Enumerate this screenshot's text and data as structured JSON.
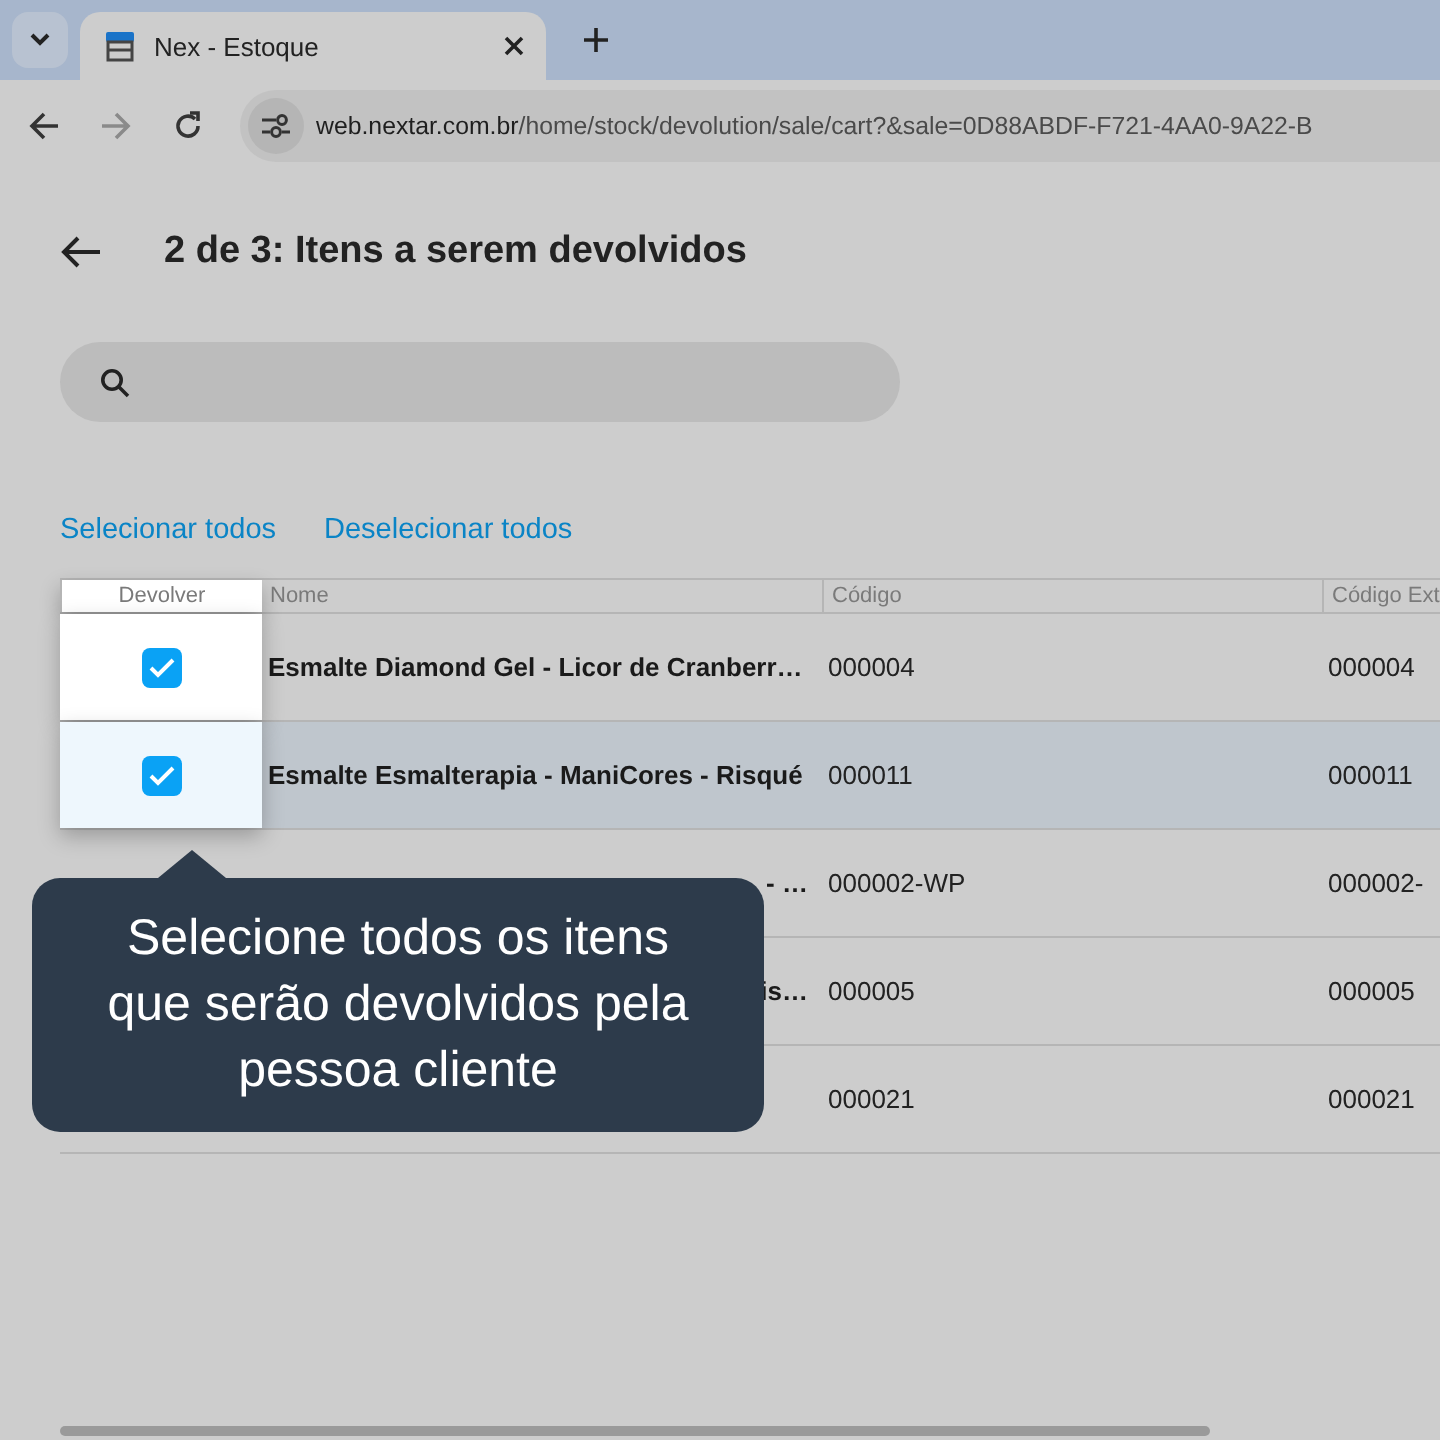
{
  "browser": {
    "tab_title": "Nex - Estoque",
    "url_host": "web.nextar.com.br",
    "url_path": "/home/stock/devolution/sale/cart?&sale=0D88ABDF-F721-4AA0-9A22-B"
  },
  "page": {
    "title": "2 de 3: Itens a serem devolvidos"
  },
  "actions": [
    "Selecionar todos",
    "Deselecionar todos"
  ],
  "table": {
    "columns": [
      "Devolver",
      "Nome",
      "Código",
      "Código Ext"
    ],
    "rows": [
      {
        "checked": true,
        "highlighted": false,
        "name": "Esmalte Diamond Gel - Licor de Cranberr…",
        "code": "000004",
        "ext_code": "000004"
      },
      {
        "checked": true,
        "highlighted": true,
        "name": "Esmalte Esmalterapia - ManiCores - Risqué",
        "code": "000011",
        "ext_code": "000011"
      },
      {
        "highlighted": false,
        "name": "- …",
        "code": "000002-WP",
        "ext_code": "000002-"
      },
      {
        "highlighted": false,
        "name": "is…",
        "code": "000005",
        "ext_code": "000005"
      },
      {
        "highlighted": false,
        "code": "000021",
        "ext_code": "000021"
      }
    ]
  },
  "tooltip": {
    "text": "Selecione todos os itens que serão devolvidos pela pessoa cliente"
  }
}
